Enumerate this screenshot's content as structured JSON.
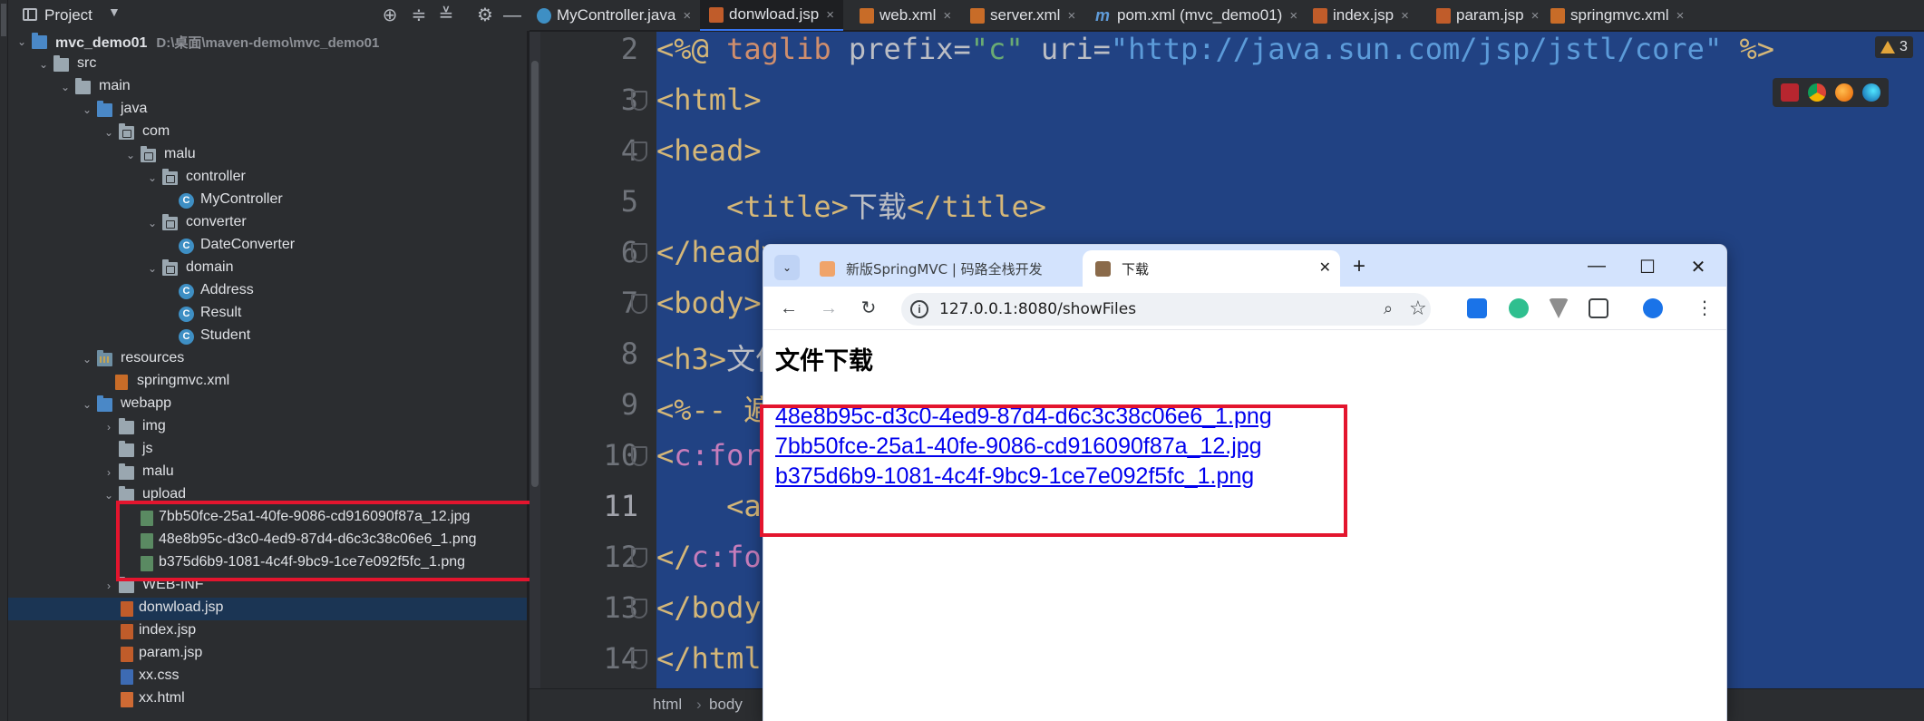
{
  "ide": {
    "project_panel": {
      "title": "Project",
      "tree": [
        {
          "label": "mvc_demo01",
          "hint": "D:\\桌面\\maven-demo\\mvc_demo01"
        },
        {
          "label": "src"
        },
        {
          "label": "main"
        },
        {
          "label": "java"
        },
        {
          "label": "com"
        },
        {
          "label": "malu"
        },
        {
          "label": "controller"
        },
        {
          "label": "MyController",
          "badge": "C"
        },
        {
          "label": "converter"
        },
        {
          "label": "DateConverter",
          "badge": "C"
        },
        {
          "label": "domain"
        },
        {
          "label": "Address",
          "badge": "C"
        },
        {
          "label": "Result",
          "badge": "C"
        },
        {
          "label": "Student",
          "badge": "C"
        },
        {
          "label": "resources"
        },
        {
          "label": "springmvc.xml"
        },
        {
          "label": "webapp"
        },
        {
          "label": "img"
        },
        {
          "label": "js"
        },
        {
          "label": "malu"
        },
        {
          "label": "upload"
        },
        {
          "label": "7bb50fce-25a1-40fe-9086-cd916090f87a_12.jpg"
        },
        {
          "label": "48e8b95c-d3c0-4ed9-87d4-d6c3c38c06e6_1.png"
        },
        {
          "label": "b375d6b9-1081-4c4f-9bc9-1ce7e092f5fc_1.png"
        },
        {
          "label": "WEB-INF"
        },
        {
          "label": "donwload.jsp"
        },
        {
          "label": "index.jsp"
        },
        {
          "label": "param.jsp"
        },
        {
          "label": "xx.css"
        },
        {
          "label": "xx.html"
        }
      ]
    },
    "tabs": [
      {
        "label": "MyController.java"
      },
      {
        "label": "donwload.jsp"
      },
      {
        "label": "web.xml"
      },
      {
        "label": "server.xml"
      },
      {
        "label": "pom.xml (mvc_demo01)"
      },
      {
        "label": "index.jsp"
      },
      {
        "label": "param.jsp"
      },
      {
        "label": "springmvc.xml"
      }
    ],
    "tab_icon_m": "m",
    "tab_close": "×",
    "line_numbers": [
      "2",
      "3",
      "4",
      "5",
      "6",
      "7",
      "8",
      "9",
      "10",
      "11",
      "12",
      "13",
      "14"
    ],
    "code": {
      "l2": {
        "a": "<%@ ",
        "b": "taglib",
        "c": " prefix=",
        "d": "\"c\"",
        "e": " uri=",
        "f": "\"http://java.sun.com/jsp/jstl/core\"",
        "g": " %>"
      },
      "l3": "<html>",
      "l4": "<head>",
      "l5": {
        "a": "    <title>",
        "b": "下载",
        "c": "</title>"
      },
      "l6": "</head>",
      "l7": "<body>",
      "l8": {
        "a": "<h3>",
        "b": "文件下载"
      },
      "l9": "<%-- 遍历",
      "l10": {
        "a": "<",
        "b": "c:forEach"
      },
      "l11": "    <a",
      "l12": {
        "a": "</",
        "b": "c:forEach"
      },
      "l13": "</body>",
      "l14": "</html>"
    },
    "warnings": "3",
    "breadcrumb": [
      "html",
      "body"
    ],
    "breadcrumb_sep": "›"
  },
  "browser": {
    "tabs": [
      {
        "title": "新版SpringMVC | 码路全栈开发"
      },
      {
        "title": "下载"
      }
    ],
    "url": "127.0.0.1:8080/showFiles",
    "page": {
      "heading": "文件下载",
      "links": [
        "48e8b95c-d3c0-4ed9-87d4-d6c3c38c06e6_1.png",
        "7bb50fce-25a1-40fe-9086-cd916090f87a_12.jpg",
        "b375d6b9-1081-4c4f-9bc9-1ce7e092f5fc_1.png"
      ]
    }
  },
  "colors": {
    "annotation": "#e3152e",
    "editor_selection": "#214283",
    "link": "#0000ee",
    "browser_tabbar": "#d3e3fd"
  }
}
